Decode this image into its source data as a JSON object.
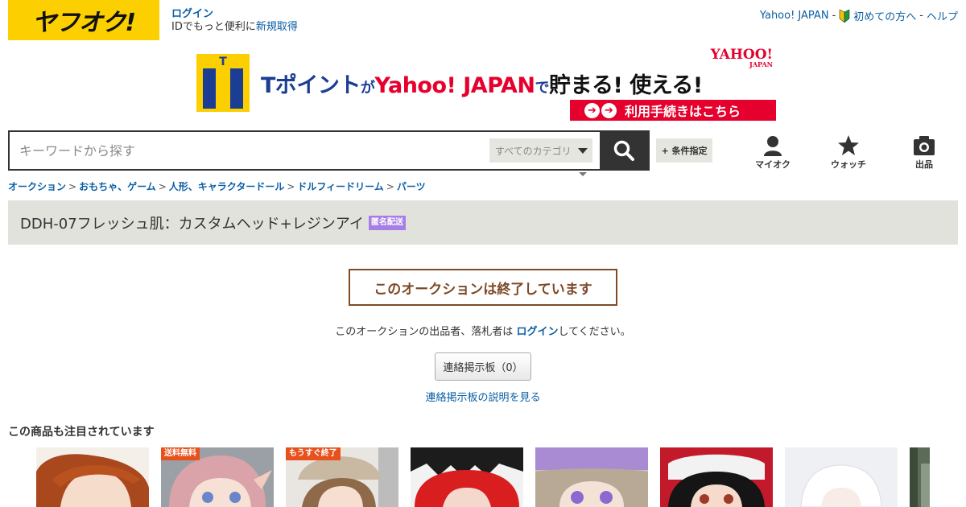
{
  "header": {
    "logo_text": "ヤフオク!",
    "login_label": "ログイン",
    "id_prompt": "IDでもっと便利に",
    "register_label": "新規取得",
    "links": [
      "Yahoo! JAPAN",
      "初めての方へ",
      "ヘルプ"
    ],
    "separator": "-"
  },
  "banner": {
    "t_letter": "T",
    "part1": "Tポイント",
    "part2": "が",
    "part3": "Yahoo! JAPAN",
    "part4": "で",
    "part5": "貯まる! 使える!",
    "yahoo_logo": "YAHOO!",
    "yahoo_logo_sub": "JAPAN",
    "cta": "利用手続きはこちら"
  },
  "search": {
    "placeholder": "キーワードから探す",
    "category": "すべてのカテゴリ",
    "conditions_label": "+ 条件指定"
  },
  "nav_icons": [
    {
      "label": "マイオク",
      "icon": "person-icon"
    },
    {
      "label": "ウォッチ",
      "icon": "star-icon"
    },
    {
      "label": "出品",
      "icon": "camera-icon"
    }
  ],
  "breadcrumb": [
    "オークション",
    "おもちゃ、ゲーム",
    "人形、キャラクタードール",
    "ドルフィードリーム",
    "パーツ"
  ],
  "breadcrumb_sep": ">",
  "item": {
    "title": "DDH-07フレッシュ肌：カスタムヘッド+レジンアイ",
    "badge": "匿名配送"
  },
  "status": {
    "ended_message": "このオークションは終了しています",
    "notice_before": "このオークションの出品者、落札者は ",
    "notice_link": "ログイン",
    "notice_after": "してください。",
    "board_button": "連絡掲示板（0）",
    "board_help": "連絡掲示板の説明を見る"
  },
  "recommendations": {
    "title": "この商品も注目されています",
    "items": [
      {
        "label": ""
      },
      {
        "label": "送料無料"
      },
      {
        "label": "もうすぐ終了"
      },
      {
        "label": ""
      },
      {
        "label": ""
      },
      {
        "label": ""
      },
      {
        "label": ""
      },
      {
        "label": ""
      }
    ]
  },
  "colors": {
    "brand_yellow": "#fcd000",
    "link_blue": "#0b5fa5",
    "ended_brown": "#7d4a28",
    "badge_purple": "#a77ee6",
    "label_orange": "#e8501c"
  }
}
